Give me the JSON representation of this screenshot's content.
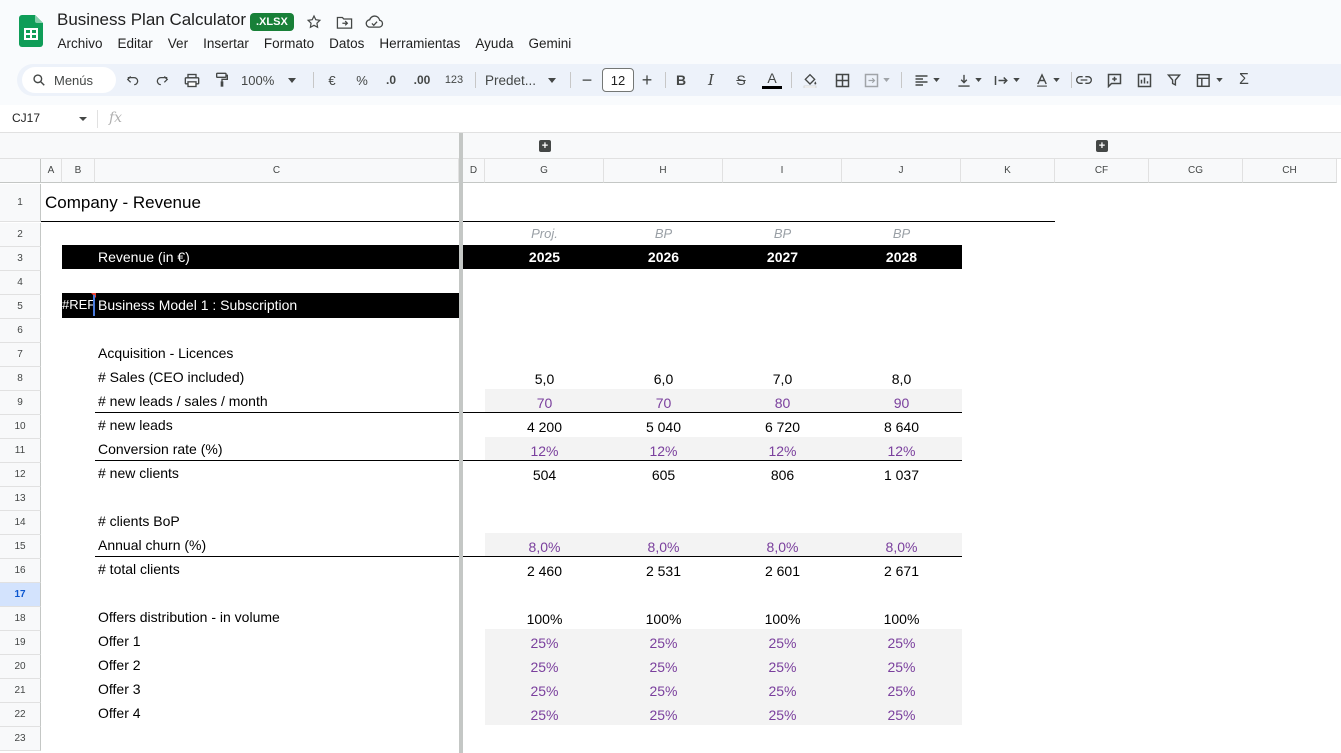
{
  "app": {
    "title": "Business Plan Calculator",
    "badge": ".XLSX",
    "brand_color": "#188038"
  },
  "menu": [
    "Archivo",
    "Editar",
    "Ver",
    "Insertar",
    "Formato",
    "Datos",
    "Herramientas",
    "Ayuda",
    "Gemini"
  ],
  "toolbar": {
    "search_label": "Menús",
    "zoom": "100%",
    "currency": "€",
    "percent": "%",
    "dec_decrease": ".0",
    "dec_increase": ".00",
    "number_format": "123",
    "font": "Predet...",
    "font_size": "12",
    "bold": "B",
    "italic": "I",
    "strike": "S",
    "text_color": "A"
  },
  "formula_bar": {
    "cell_ref": "CJ17",
    "fx": "fx"
  },
  "columns": [
    "A",
    "B",
    "C",
    "D",
    "G",
    "H",
    "I",
    "J",
    "K",
    "CF",
    "CG",
    "CH"
  ],
  "rows": [
    "1",
    "2",
    "3",
    "4",
    "5",
    "6",
    "7",
    "8",
    "9",
    "10",
    "11",
    "12",
    "13",
    "14",
    "15",
    "16",
    "17",
    "18",
    "19",
    "20",
    "21",
    "22",
    "23"
  ],
  "active_row": "17",
  "sheet": {
    "title": "Company - Revenue",
    "year_types": [
      "Proj.",
      "BP",
      "BP",
      "BP"
    ],
    "revenue_header": "Revenue (in €)",
    "years": [
      "2025",
      "2026",
      "2027",
      "2028"
    ],
    "ref_error": "#REF!",
    "model_title": "Business Model 1 : Subscription",
    "labels": {
      "acquisition": "Acquisition - Licences",
      "sales": "# Sales (CEO included)",
      "new_leads_per_sale": "# new leads / sales / month",
      "new_leads": "# new leads",
      "conversion": "Conversion rate (%)",
      "new_clients": "# new clients",
      "clients_bop": "# clients BoP",
      "churn": "Annual churn (%)",
      "total_clients": "# total clients",
      "offers_dist": "Offers distribution - in volume",
      "offer1": "Offer 1",
      "offer2": "Offer 2",
      "offer3": "Offer 3",
      "offer4": "Offer 4"
    },
    "values": {
      "sales": [
        "5,0",
        "6,0",
        "7,0",
        "8,0"
      ],
      "new_leads_per_sale": [
        "70",
        "70",
        "80",
        "90"
      ],
      "new_leads": [
        "4 200",
        "5 040",
        "6 720",
        "8 640"
      ],
      "conversion": [
        "12%",
        "12%",
        "12%",
        "12%"
      ],
      "new_clients": [
        "504",
        "605",
        "806",
        "1 037"
      ],
      "churn": [
        "8,0%",
        "8,0%",
        "8,0%",
        "8,0%"
      ],
      "total_clients": [
        "2 460",
        "2 531",
        "2 601",
        "2 671"
      ],
      "offers_dist": [
        "100%",
        "100%",
        "100%",
        "100%"
      ],
      "offer1": [
        "25%",
        "25%",
        "25%",
        "25%"
      ],
      "offer2": [
        "25%",
        "25%",
        "25%",
        "25%"
      ],
      "offer3": [
        "25%",
        "25%",
        "25%",
        "25%"
      ],
      "offer4": [
        "25%",
        "25%",
        "25%",
        "25%"
      ]
    },
    "input_color": "#7a3f9d"
  }
}
